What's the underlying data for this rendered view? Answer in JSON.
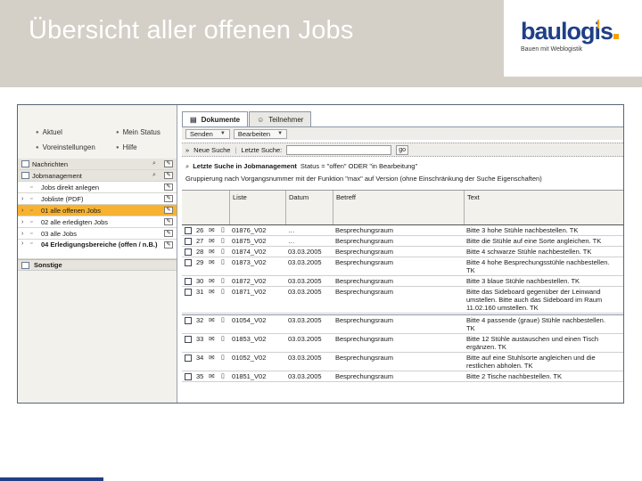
{
  "slide": {
    "title": "Übersicht aller offenen Jobs",
    "logo_text": "baulogis",
    "logo_tagline": "Bauen mit Weblogistik",
    "colors": {
      "header_bg": "#d4d0c8",
      "logo_blue": "#1f3f86",
      "accent_orange": "#f2a400",
      "selected_row": "#f6b230"
    }
  },
  "left_nav": {
    "quick": [
      {
        "label": "Aktuel",
        "icon": "bullet-icon"
      },
      {
        "label": "Mein Status",
        "icon": "bullet-icon"
      },
      {
        "label": "Voreinstellungen",
        "icon": "bullet-icon"
      },
      {
        "label": "Hilfe",
        "icon": "bullet-icon"
      }
    ],
    "tree": [
      {
        "label": "Nachrichten",
        "type": "group",
        "action": "search-icon"
      },
      {
        "label": "Jobmanagement",
        "type": "group",
        "action": "search-icon"
      },
      {
        "label": "Jobs direkt anlegen",
        "type": "item"
      },
      {
        "label": "Jobliste (PDF)",
        "type": "item"
      },
      {
        "label": "01 alle offenen Jobs",
        "type": "item",
        "selected": true
      },
      {
        "label": "02 alle erledigten Jobs",
        "type": "item"
      },
      {
        "label": "03 alle Jobs",
        "type": "item"
      },
      {
        "label": "04 Erledigungsbereiche (offen / n.B.)",
        "type": "item"
      }
    ],
    "sonstige": "Sonstige"
  },
  "tabs": [
    {
      "label": "Dokumente",
      "active": true,
      "icon": "document-icon"
    },
    {
      "label": "Teilnehmer",
      "active": false,
      "icon": "user-icon"
    }
  ],
  "toolbar": {
    "send_label": "Senden",
    "edit_label": "Bearbeiten",
    "new_search": "Neue Suche",
    "last_search": "Letzte Suche:",
    "search_value": "",
    "go_label": "go"
  },
  "search_title": {
    "bold": "Letzte Suche in Jobmanagement",
    "rest": "Status = \"offen\" ODER \"in Bearbeitung\""
  },
  "grouping": "Gruppierung nach Vorgangsnummer mit der Funktion \"max\" auf Version (ohne Einschränkung der Suche Eigenschaften)",
  "columns": [
    "Liste",
    "Datum",
    "Betreff",
    "Text"
  ],
  "rows": [
    {
      "num": "26",
      "doc": "01876_V02",
      "date": "…",
      "type": "Besprechungsraum",
      "text": "Bitte 3 hohe Stühle nachbestellen. TK"
    },
    {
      "num": "27",
      "doc": "01875_V02",
      "date": "…",
      "type": "Besprechungsraum",
      "text": "Bitte die Stühle auf eine Sorte angleichen. TK"
    },
    {
      "num": "28",
      "doc": "01874_V02",
      "date": "03.03.2005",
      "type": "Besprechungsraum",
      "text": "Bitte 4 schwarze Stühle nachbestellen. TK"
    },
    {
      "num": "29",
      "doc": "01873_V02",
      "date": "03.03.2005",
      "type": "Besprechungsraum",
      "text": "Bitte 4 hohe Besprechungsstühle nachbestellen. TK"
    },
    {
      "num": "30",
      "doc": "01872_V02",
      "date": "03.03.2005",
      "type": "Besprechungsraum",
      "text": "Bitte 3 blaue Stühle nachbestellen. TK"
    },
    {
      "num": "31",
      "doc": "01871_V02",
      "date": "03.03.2005",
      "type": "Besprechungsraum",
      "text": "Bitte das Sideboard gegenüber der Leinwand umstellen. Bitte auch das Sideboard im Raum 11.02.160 umstellen. TK"
    },
    {
      "num": "32",
      "doc": "01054_V02",
      "date": "03.03.2005",
      "type": "Besprechungsraum",
      "text": "Bitte 4 passende (graue) Stühle nachbestellen. TK"
    },
    {
      "num": "33",
      "doc": "01853_V02",
      "date": "03.03.2005",
      "type": "Besprechungsraum",
      "text": "Bitte 12 Stühle austauschen und einen Tisch ergänzen. TK"
    },
    {
      "num": "34",
      "doc": "01052_V02",
      "date": "03.03.2005",
      "type": "Besprechungsraum",
      "text": "Bitte auf eine Stuhlsorte angleichen und die restlichen abholen. TK"
    },
    {
      "num": "35",
      "doc": "01851_V02",
      "date": "03.03.2005",
      "type": "Besprechungsraum",
      "text": "Bitte 2 Tische nachbestellen. TK"
    }
  ]
}
